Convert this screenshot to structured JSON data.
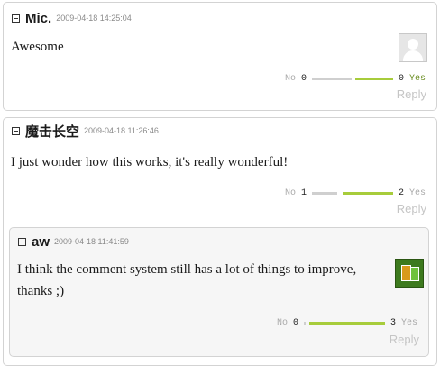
{
  "comments": [
    {
      "author": "Mic.",
      "date": "2009-04-18 14:25:04",
      "text": "Awesome",
      "avatar": "default-user-icon",
      "votes": {
        "no_label": "No",
        "no_count": "0",
        "yes_label": "Yes",
        "yes_count": "0"
      },
      "reply_label": "Reply"
    },
    {
      "author": "魔击长空",
      "date": "2009-04-18 11:26:46",
      "text": "I just wonder how this works, it's really wonderful!",
      "votes": {
        "no_label": "No",
        "no_count": "1",
        "yes_label": "Yes",
        "yes_count": "2"
      },
      "reply_label": "Reply",
      "replies": [
        {
          "author": "aw",
          "date": "2009-04-18 11:41:59",
          "text": "I think the comment system still has a lot of things to improve, thanks ;)",
          "avatar": "green-game-avatar-icon",
          "votes": {
            "no_label": "No",
            "no_count": "0",
            "yes_label": "Yes",
            "yes_count": "3"
          },
          "reply_label": "Reply"
        }
      ]
    }
  ],
  "colors": {
    "vote_yes": "#a7cc3b",
    "vote_no": "#cfcfcf",
    "reply_link": "#c5c5c5"
  }
}
